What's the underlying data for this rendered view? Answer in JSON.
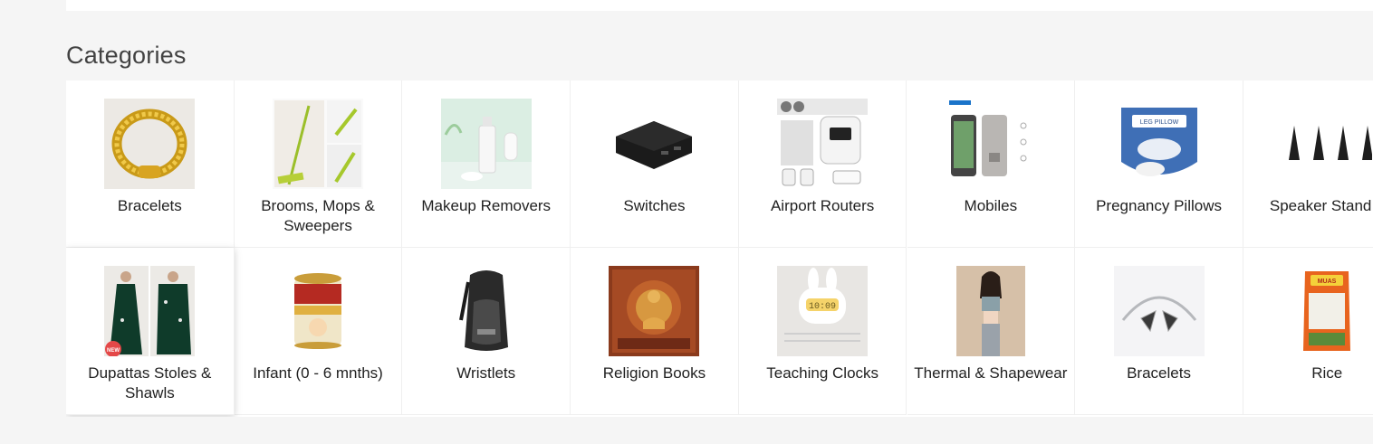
{
  "section": {
    "title": "Categories"
  },
  "categories": [
    {
      "label": "Bracelets",
      "icon": "gold-bracelet-icon"
    },
    {
      "label": "Brooms, Mops & Sweepers",
      "icon": "mop-icon"
    },
    {
      "label": "Makeup Removers",
      "icon": "makeup-remover-icon"
    },
    {
      "label": "Switches",
      "icon": "switch-box-icon"
    },
    {
      "label": "Airport Routers",
      "icon": "pocket-router-icon"
    },
    {
      "label": "Mobiles",
      "icon": "smartphone-icon"
    },
    {
      "label": "Pregnancy Pillows",
      "icon": "leg-pillow-icon"
    },
    {
      "label": "Speaker Stand",
      "icon": "speaker-spikes-icon"
    },
    {
      "label": "Dupattas Stoles & Shawls",
      "icon": "dupatta-icon"
    },
    {
      "label": "Infant (0 - 6 mnths)",
      "icon": "formula-tin-icon"
    },
    {
      "label": "Wristlets",
      "icon": "backpack-icon"
    },
    {
      "label": "Religion Books",
      "icon": "thangka-painting-icon"
    },
    {
      "label": "Teaching Clocks",
      "icon": "bunny-clock-icon"
    },
    {
      "label": "Thermal & Shapewear",
      "icon": "model-photo-icon"
    },
    {
      "label": "Bracelets",
      "icon": "silver-cuff-icon"
    },
    {
      "label": "Rice",
      "icon": "rice-pack-icon"
    }
  ],
  "thumb_text": {
    "new_badge": "NEW",
    "pillow_brand": "LEG PILLOW",
    "clock_time": "10:09",
    "rice_brand": "MUAS"
  },
  "colors": {
    "page_bg": "#f5f5f5",
    "card_bg": "#ffffff",
    "title": "#424242",
    "label": "#212121",
    "grid_line": "#efefef"
  }
}
